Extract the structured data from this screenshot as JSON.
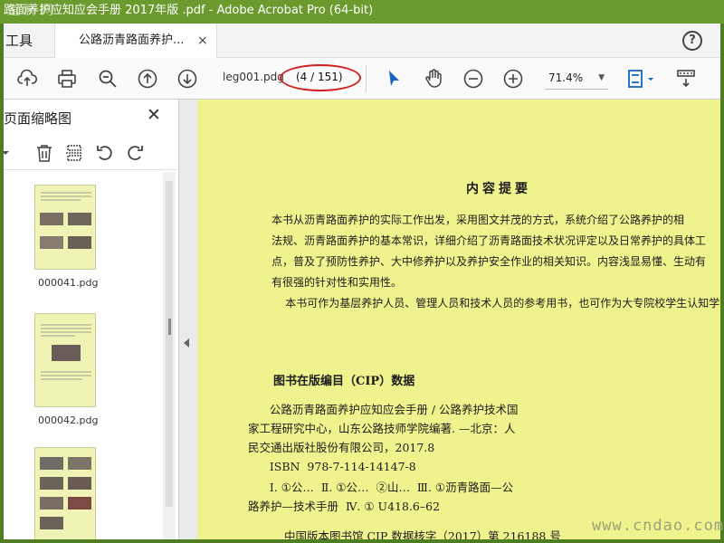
{
  "window": {
    "title": "路面养护应知应会手册 2017年版 .pdf - Adobe Acrobat Pro (64-bit)",
    "watermark_top": "道 林 网",
    "frame_color": "#4f7d22"
  },
  "tabs": {
    "tools_label": "工具",
    "document_label": "公路沥青路面养护...",
    "close_glyph": "×",
    "help_glyph": "?"
  },
  "toolbar": {
    "filename": "leg001.pdg",
    "page_indicator": "(4 / 151)",
    "zoom_value": "71.4%",
    "icons": [
      "upload-cloud-icon",
      "print-icon",
      "zoom-search-icon",
      "prev-page-icon",
      "next-page-icon",
      "select-arrow-icon",
      "hand-icon",
      "zoom-out-icon",
      "zoom-in-icon",
      "page-fit-icon",
      "more-tools-icon"
    ],
    "annotation_color": "#d32020"
  },
  "panel": {
    "title": "页面缩略图",
    "close_glyph": "✕",
    "icons": [
      "panel-options-icon",
      "delete-icon",
      "extract-icon",
      "rotate-left-icon",
      "rotate-right-icon"
    ],
    "thumbnails": [
      {
        "label": "000041.pdg"
      },
      {
        "label": "000042.pdg"
      },
      {
        "label": ""
      }
    ]
  },
  "page": {
    "background": "#eef38d",
    "title": "内容提要",
    "paragraph": "本书从沥青路面养护的实际工作出发，采用图文并茂的方式，系统介绍了公路养护的相\n法规、沥青路面养护的基本常识，详细介绍了沥青路面技术状况评定以及日常养护的具体工\n点，普及了预防性养护、大中修养护以及养护安全作业的相关知识。内容浅显易懂、生动有\n有很强的针对性和实用性。\n    本书可作为基层养护人员、管理人员和技术人员的参考用书，也可作为大专院校学生认知学习",
    "cip_title": "图书在版编目（CIP）数据",
    "cip_text": "      公路沥青路面养护应知应会手册 / 公路养护技术国\n家工程研究中心，山东公路技师学院编著. —北京：人\n民交通出版社股份有限公司，2017.8\n      ISBN  978-7-114-14147-8",
    "classification": "      Ⅰ. ①公…  Ⅱ. ①公…  ②山…  Ⅲ. ①沥青路面—公\n路养护—技术手册  Ⅳ. ① U418.6–62",
    "footer": "中国版本图书馆 CIP 数据核字（2017）第 216188 号"
  },
  "watermark_bottom": "www.cndao.com"
}
